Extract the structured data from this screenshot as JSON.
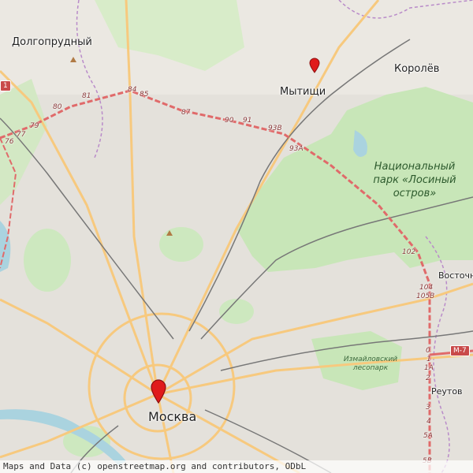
{
  "map": {
    "places": {
      "moscow": "Москва",
      "mytishchi": "Мытищи",
      "korolyov": "Королёв",
      "dolgoprudny": "Долгопрудный",
      "vostochny": "Восточны",
      "reutov": "Реутов"
    },
    "national_park": "Национальный парк «Лосиный остров»",
    "national_park_lines": [
      "Национальный",
      "парк «Лосиный",
      "остров»"
    ],
    "izmailovo_park_lines": [
      "Измайловский",
      "лесопарк"
    ],
    "mkad_km": [
      "84",
      "85",
      "81",
      "80",
      "79",
      "77",
      "76",
      "87",
      "90",
      "91",
      "93В",
      "93А",
      "102",
      "104",
      "105В",
      "0",
      "1",
      "1A",
      "2",
      "3",
      "4",
      "5A",
      "5B"
    ],
    "road_shield": "M-7",
    "shield_edge": "1",
    "markers": [
      {
        "name": "Moscow center",
        "color": "#e01b1b"
      },
      {
        "name": "Mytishchi",
        "color": "#e01b1b"
      }
    ],
    "attribution": "Maps and Data (c) openstreetmap.org and contributors, ODbL",
    "colors": {
      "background": "#f2efe9",
      "urban": "#dddad4",
      "forest": "#c8e6b8",
      "major_road": "#f7c97e",
      "mkad": "#e06a6a",
      "railway": "#777777",
      "water": "#aad3df",
      "boundary": "#b98bc9"
    }
  }
}
